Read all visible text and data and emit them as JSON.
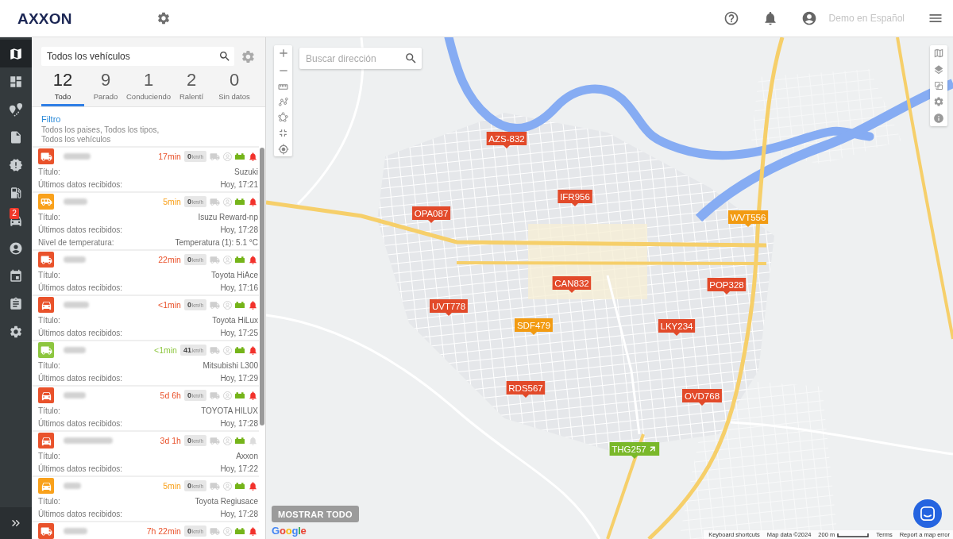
{
  "header": {
    "logo": "AXXON",
    "user_name": "Demo en Español"
  },
  "nav": [
    {
      "kind": "map",
      "selected": true
    },
    {
      "kind": "dashboard",
      "selected": false
    },
    {
      "kind": "routes",
      "selected": false
    },
    {
      "kind": "documents",
      "selected": false
    },
    {
      "kind": "alerts",
      "selected": false
    },
    {
      "kind": "fuel",
      "selected": false
    },
    {
      "kind": "vehicles",
      "selected": false,
      "badge": "2"
    },
    {
      "kind": "drivers",
      "selected": false
    },
    {
      "kind": "calendar",
      "selected": false
    },
    {
      "kind": "tasks",
      "selected": false
    },
    {
      "kind": "settings",
      "selected": false
    }
  ],
  "vehicle_panel": {
    "search": {
      "value": "Todos los vehículos"
    },
    "status_tabs": [
      {
        "count": "12",
        "label": "Todo",
        "selected": true
      },
      {
        "count": "9",
        "label": "Parado",
        "selected": false
      },
      {
        "count": "1",
        "label": "Conduciendo",
        "selected": false
      },
      {
        "count": "2",
        "label": "Ralentí",
        "selected": false
      },
      {
        "count": "0",
        "label": "Sin datos",
        "selected": false
      }
    ],
    "filter": {
      "title": "Filtro",
      "summary": "Todos los paises, Todos los tipos, Todos los vehículos"
    },
    "vehicles": [
      {
        "kind": "truck",
        "color": "#e9522b",
        "age": "17min",
        "speed": "0",
        "unit": "km/h",
        "alarm": true,
        "details": [
          {
            "label": "Título:",
            "value": "Suzuki"
          },
          {
            "label": "Últimos datos recibidos:",
            "value": "Hoy, 17:21"
          }
        ]
      },
      {
        "kind": "van",
        "color": "#f9a11b",
        "age": "5min",
        "speed": "0",
        "unit": "km/h",
        "alarm": true,
        "details": [
          {
            "label": "Título:",
            "value": "Isuzu Reward-np"
          },
          {
            "label": "Últimos datos recibidos:",
            "value": "Hoy, 17:28"
          },
          {
            "label": "Nivel de temperatura:",
            "value": "Temperatura (1): 5.1 °C"
          }
        ]
      },
      {
        "kind": "truck",
        "color": "#e9522b",
        "age": "22min",
        "speed": "0",
        "unit": "km/h",
        "alarm": true,
        "details": [
          {
            "label": "Título:",
            "value": "Toyota HiAce"
          },
          {
            "label": "Últimos datos recibidos:",
            "value": "Hoy, 17:16"
          }
        ]
      },
      {
        "kind": "car",
        "color": "#e9522b",
        "age": "<1min",
        "speed": "0",
        "unit": "km/h",
        "alarm": true,
        "details": [
          {
            "label": "Título:",
            "value": "Toyota HiLux"
          },
          {
            "label": "Últimos datos recibidos:",
            "value": "Hoy, 17:25"
          }
        ]
      },
      {
        "kind": "truck",
        "color": "#8dc63f",
        "age": "<1min",
        "speed": "41",
        "unit": "km/h",
        "alarm": true,
        "details": [
          {
            "label": "Título:",
            "value": "Mitsubishi L300"
          },
          {
            "label": "Últimos datos recibidos:",
            "value": "Hoy, 17:29"
          }
        ]
      },
      {
        "kind": "car",
        "color": "#e9522b",
        "age": "5d 6h",
        "speed": "0",
        "unit": "km/h",
        "alarm": true,
        "details": [
          {
            "label": "Título:",
            "value": "TOYOTA HILUX"
          },
          {
            "label": "Últimos datos recibidos:",
            "value": "Hoy, 17:28"
          }
        ]
      },
      {
        "kind": "car",
        "color": "#e9522b",
        "age": "3d 1h",
        "speed": "0",
        "unit": "km/h",
        "alarm": false,
        "details": [
          {
            "label": "Título:",
            "value": "Axxon"
          },
          {
            "label": "Últimos datos recibidos:",
            "value": "Hoy, 17:22"
          }
        ]
      },
      {
        "kind": "car",
        "color": "#f9a11b",
        "age": "5min",
        "speed": "0",
        "unit": "km/h",
        "alarm": true,
        "details": [
          {
            "label": "Título:",
            "value": "Toyota Regiusace"
          },
          {
            "label": "Últimos datos recibidos:",
            "value": "Hoy, 17:28"
          }
        ]
      },
      {
        "kind": "truck",
        "color": "#e9522b",
        "age": "7h 22min",
        "speed": "0",
        "unit": "km/h",
        "alarm": true
      }
    ]
  },
  "map": {
    "search": {
      "placeholder": "Buscar dirección"
    },
    "markers": [
      {
        "label": "AZS-832",
        "color": "#e24a2a",
        "moving": false
      },
      {
        "label": "IFR956",
        "color": "#e24a2a",
        "moving": false
      },
      {
        "label": "OPA087",
        "color": "#e24a2a",
        "moving": false
      },
      {
        "label": "WVT556",
        "color": "#f29b12",
        "moving": false
      },
      {
        "label": "CAN832",
        "color": "#e24a2a",
        "moving": false
      },
      {
        "label": "POP328",
        "color": "#e24a2a",
        "moving": false
      },
      {
        "label": "UVT778",
        "color": "#e24a2a",
        "moving": false
      },
      {
        "label": "SDF479",
        "color": "#f29b12",
        "moving": false
      },
      {
        "label": "LKY234",
        "color": "#e24a2a",
        "moving": false
      },
      {
        "label": "RDS567",
        "color": "#e24a2a",
        "moving": false
      },
      {
        "label": "OVD768",
        "color": "#e24a2a",
        "moving": false
      },
      {
        "label": "THG257",
        "color": "#7ab82a",
        "moving": true
      }
    ],
    "show_all": "MOSTRAR TODO",
    "logo": "Google",
    "footer": [
      {
        "kind": "link",
        "text": "Keyboard shortcuts"
      },
      {
        "kind": "text",
        "text": "Map data ©2024"
      },
      {
        "kind": "scale",
        "text": "200 m"
      },
      {
        "kind": "link",
        "text": "Terms"
      },
      {
        "kind": "link",
        "text": "Report a map error"
      }
    ]
  }
}
